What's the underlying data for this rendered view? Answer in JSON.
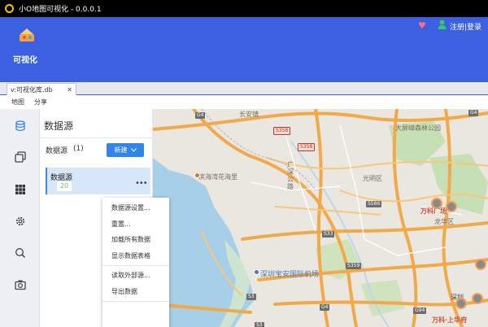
{
  "window": {
    "title": "小O地图可视化 - 0.0.0.1"
  },
  "header": {
    "logo_label": "可视化",
    "auth_text": "注册|登录",
    "heart_icon": "heart-icon",
    "user_icon": "user-icon",
    "color": "#3b61e0"
  },
  "tabs": [
    {
      "label": "v:可视化库.db",
      "close": "✕"
    }
  ],
  "menu": {
    "items": [
      "地图",
      "分享"
    ]
  },
  "toolrail": {
    "icons": [
      "database-icon",
      "copy-icon",
      "grid-icon",
      "settings-icon",
      "search-icon",
      "camera-icon"
    ]
  },
  "panel": {
    "title": "数据源",
    "list_label": "数据源",
    "list_count": "(1)",
    "new_button": "新建",
    "card": {
      "name": "数据源",
      "badge": "20",
      "more": "•••"
    }
  },
  "context_menu": {
    "group1": [
      "数据源设置...",
      "重置...",
      "加载所有数据",
      "显示数据表格"
    ],
    "group2": [
      "读取外部源...",
      "导出数据"
    ]
  },
  "map": {
    "labels": {
      "changan": "长安镇",
      "binhai": "滨海湾花海里",
      "guangshen": "广深公路",
      "dapeng": "大屏嶂森林公园",
      "guangming": "光明区",
      "longhua": "龙华区",
      "airport": "深圳宝安国际机场",
      "wanke1": "万科广场",
      "wanke2": "万科·上华府",
      "shenzhen_partial": "深圳"
    },
    "shields": {
      "g4_top": "G4",
      "s358": "S358",
      "s358b": "S358",
      "s586": "S586",
      "s33": "S33",
      "s359": "S359",
      "s3": "S3",
      "g4_bot": "G4",
      "g4_mid": "G4",
      "g94": "G94",
      "s3b": "S3"
    }
  }
}
